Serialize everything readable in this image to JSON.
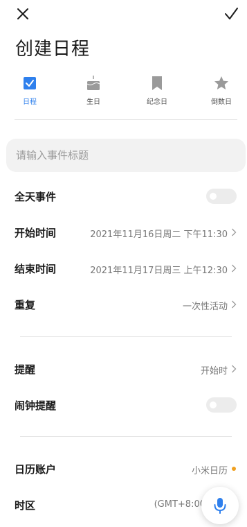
{
  "header": {
    "title": "创建日程",
    "close_icon": "close-icon",
    "confirm_icon": "checkmark-icon"
  },
  "event_types": [
    {
      "label": "日程",
      "icon": "checkbox-icon",
      "active": true
    },
    {
      "label": "生日",
      "icon": "cake-icon",
      "active": false
    },
    {
      "label": "纪念日",
      "icon": "bookmark-icon",
      "active": false
    },
    {
      "label": "倒数日",
      "icon": "star-icon",
      "active": false
    }
  ],
  "title_input": {
    "placeholder": "请输入事件标题",
    "value": ""
  },
  "fields": {
    "all_day": {
      "label": "全天事件",
      "on": false
    },
    "start": {
      "label": "开始时间",
      "value": "2021年11月16日周二 下午11:30"
    },
    "end": {
      "label": "结束时间",
      "value": "2021年11月17日周三 上午12:30"
    },
    "repeat": {
      "label": "重复",
      "value": "一次性活动"
    },
    "reminder": {
      "label": "提醒",
      "value": "开始时"
    },
    "alarm": {
      "label": "闹钟提醒",
      "on": false
    },
    "account": {
      "label": "日历账户",
      "value": "小米日历"
    },
    "timezone": {
      "label": "时区",
      "value": "(GMT+8:00"
    }
  },
  "colors": {
    "accent": "#2f80ed",
    "account_dot": "#f0a020"
  },
  "fab": {
    "icon": "microphone-icon"
  }
}
